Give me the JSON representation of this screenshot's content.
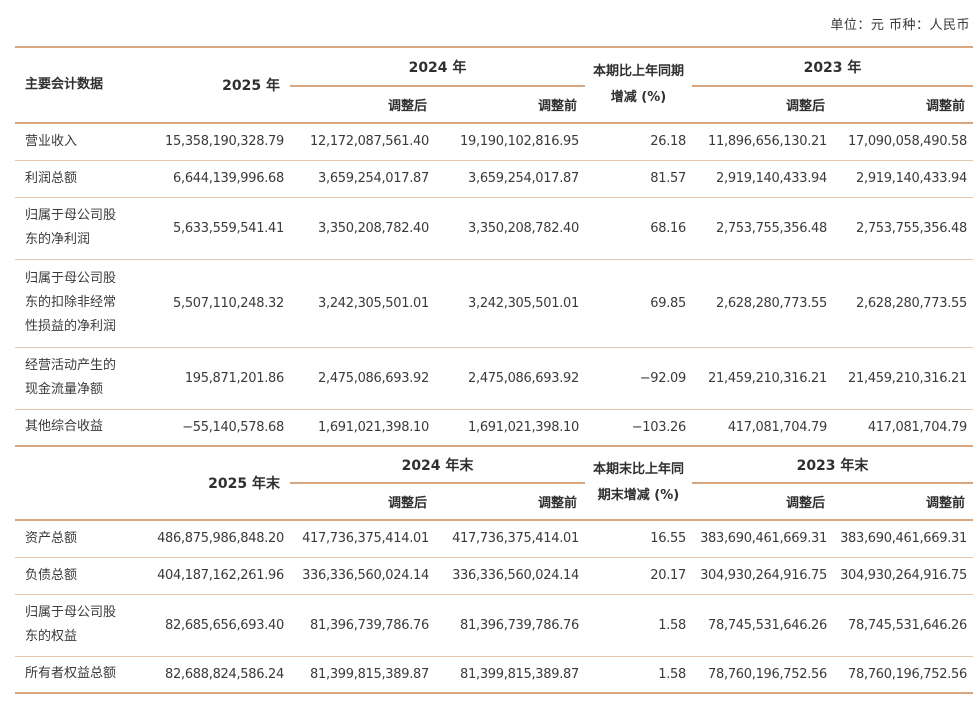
{
  "unit_label": "单位：元  币种：人民币",
  "section1": {
    "header": {
      "col0": "主要会计数据",
      "col1": "2025 年",
      "group_prev": "2024 年",
      "change": "本期比上年同期增减 (%)",
      "group_prev2": "2023 年",
      "adjusted_after": "调整后",
      "adjusted_before": "调整前"
    },
    "rows": [
      {
        "label": "营业收入",
        "v2025": "15,358,190,328.79",
        "v2024a": "12,172,087,561.40",
        "v2024b": "19,190,102,816.95",
        "chg": "26.18",
        "v2023a": "11,896,656,130.21",
        "v2023b": "17,090,058,490.58"
      },
      {
        "label": "利润总额",
        "v2025": "6,644,139,996.68",
        "v2024a": "3,659,254,017.87",
        "v2024b": "3,659,254,017.87",
        "chg": "81.57",
        "v2023a": "2,919,140,433.94",
        "v2023b": "2,919,140,433.94"
      },
      {
        "label": "归属于母公司股东的净利润",
        "v2025": "5,633,559,541.41",
        "v2024a": "3,350,208,782.40",
        "v2024b": "3,350,208,782.40",
        "chg": "68.16",
        "v2023a": "2,753,755,356.48",
        "v2023b": "2,753,755,356.48"
      },
      {
        "label": "归属于母公司股东的扣除非经常性损益的净利润",
        "v2025": "5,507,110,248.32",
        "v2024a": "3,242,305,501.01",
        "v2024b": "3,242,305,501.01",
        "chg": "69.85",
        "v2023a": "2,628,280,773.55",
        "v2023b": "2,628,280,773.55"
      },
      {
        "label": "经营活动产生的现金流量净额",
        "v2025": "195,871,201.86",
        "v2024a": "2,475,086,693.92",
        "v2024b": "2,475,086,693.92",
        "chg": "−92.09",
        "v2023a": "21,459,210,316.21",
        "v2023b": "21,459,210,316.21"
      },
      {
        "label": "其他综合收益",
        "v2025": "−55,140,578.68",
        "v2024a": "1,691,021,398.10",
        "v2024b": "1,691,021,398.10",
        "chg": "−103.26",
        "v2023a": "417,081,704.79",
        "v2023b": "417,081,704.79"
      }
    ]
  },
  "section2": {
    "header": {
      "col1": "2025 年末",
      "group_prev": "2024 年末",
      "change": "本期末比上年同期末增减 (%)",
      "group_prev2": "2023 年末",
      "adjusted_after": "调整后",
      "adjusted_before": "调整前"
    },
    "rows": [
      {
        "label": "资产总额",
        "v2025": "486,875,986,848.20",
        "v2024a": "417,736,375,414.01",
        "v2024b": "417,736,375,414.01",
        "chg": "16.55",
        "v2023a": "383,690,461,669.31",
        "v2023b": "383,690,461,669.31"
      },
      {
        "label": "负债总额",
        "v2025": "404,187,162,261.96",
        "v2024a": "336,336,560,024.14",
        "v2024b": "336,336,560,024.14",
        "chg": "20.17",
        "v2023a": "304,930,264,916.75",
        "v2023b": "304,930,264,916.75"
      },
      {
        "label": "归属于母公司股东的权益",
        "v2025": "82,685,656,693.40",
        "v2024a": "81,396,739,786.76",
        "v2024b": "81,396,739,786.76",
        "chg": "1.58",
        "v2023a": "78,745,531,646.26",
        "v2023b": "78,745,531,646.26"
      },
      {
        "label": "所有者权益总额",
        "v2025": "82,688,824,586.24",
        "v2024a": "81,399,815,389.87",
        "v2024b": "81,399,815,389.87",
        "chg": "1.58",
        "v2023a": "78,760,196,752.56",
        "v2023b": "78,760,196,752.56"
      }
    ]
  }
}
